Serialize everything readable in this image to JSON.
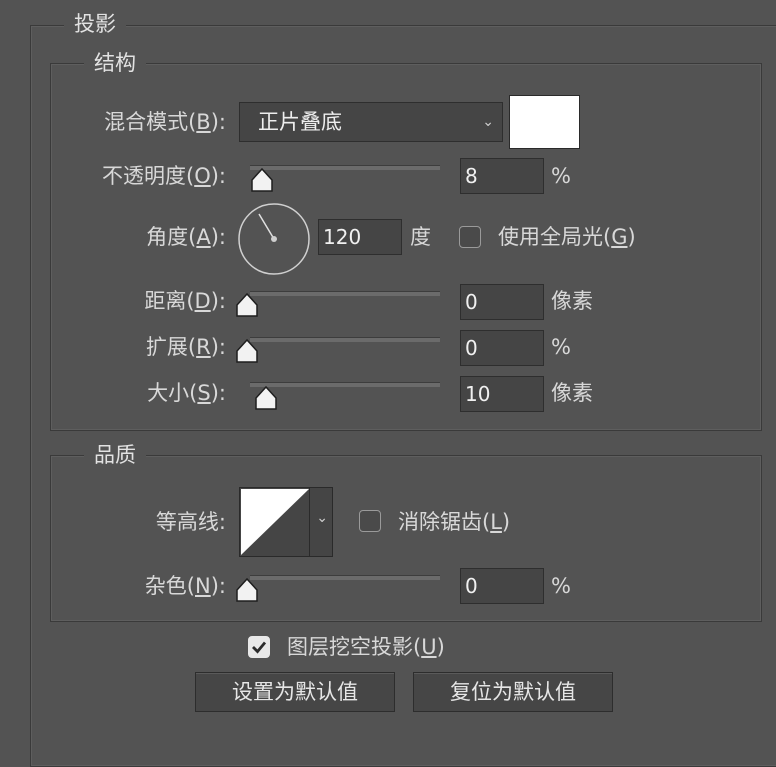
{
  "section_title": "投影",
  "structure": {
    "title": "结构",
    "blend_mode": {
      "label": "混合模式(",
      "key": "B",
      "suffix": "):",
      "value": "正片叠底"
    },
    "color_swatch": "#ffffff",
    "opacity": {
      "label": "不透明度(",
      "key": "O",
      "suffix": "):",
      "value": "8",
      "unit": "%",
      "fraction": 0.08
    },
    "angle": {
      "label": "角度(",
      "key": "A",
      "suffix": "):",
      "value": "120",
      "unit": "度",
      "global_light": {
        "label": "使用全局光(",
        "key": "G",
        "suffix": ")",
        "checked": false
      }
    },
    "distance": {
      "label": "距离(",
      "key": "D",
      "suffix": "):",
      "value": "0",
      "unit": "像素",
      "fraction": 0
    },
    "spread": {
      "label": "扩展(",
      "key": "R",
      "suffix": "):",
      "value": "0",
      "unit": "%",
      "fraction": 0
    },
    "size": {
      "label": "大小(",
      "key": "S",
      "suffix": "):",
      "value": "10",
      "unit": "像素",
      "fraction": 0.1
    }
  },
  "quality": {
    "title": "品质",
    "contour": {
      "label": "等高线:",
      "anti_alias": {
        "label": "消除锯齿(",
        "key": "L",
        "suffix": ")",
        "checked": false
      }
    },
    "noise": {
      "label": "杂色(",
      "key": "N",
      "suffix": "):",
      "value": "0",
      "unit": "%",
      "fraction": 0
    }
  },
  "knockout": {
    "label": "图层挖空投影(",
    "key": "U",
    "suffix": ")",
    "checked": true
  },
  "buttons": {
    "set_default": "设置为默认值",
    "reset_default": "复位为默认值"
  },
  "colors": {
    "panel": "#535353",
    "field": "#454545"
  }
}
